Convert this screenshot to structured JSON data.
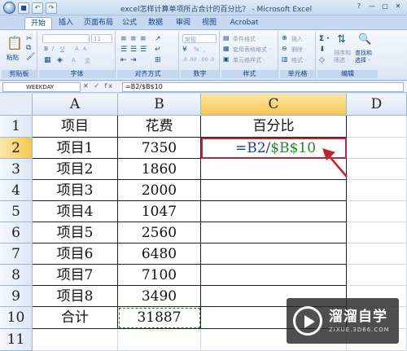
{
  "window": {
    "title": "excel怎样计算单项所占合计的百分比？ - Microsoft Excel",
    "controls": [
      "?",
      "—",
      "▢",
      "✕"
    ]
  },
  "qat": {
    "undo": "↶",
    "redo": "↷"
  },
  "tabs": [
    {
      "label": "开始",
      "active": true
    },
    {
      "label": "插入"
    },
    {
      "label": "页面布局"
    },
    {
      "label": "公式"
    },
    {
      "label": "数据"
    },
    {
      "label": "审阅"
    },
    {
      "label": "视图"
    },
    {
      "label": "Acrobat"
    }
  ],
  "ribbon": {
    "clipboard": {
      "label": "剪贴板",
      "paste": "粘贴"
    },
    "font": {
      "label": "字体",
      "size": "11",
      "bold": "B",
      "italic": "I",
      "underline": "U",
      "grow": "A",
      "shrink": "A",
      "color": "A",
      "wen": "文"
    },
    "alignment": {
      "label": "对齐方式"
    },
    "number": {
      "label": "数字",
      "format": "常规",
      "percent": "%",
      "comma": ",",
      "dec_inc": ".0 .00",
      "dec_dec": ".00 .0"
    },
    "styles": {
      "label": "样式",
      "cond": "条件格式 ·",
      "table": "套用表格格式 ·",
      "cell": "单元格样式 ·"
    },
    "cells": {
      "label": "单元格",
      "insert": "插入 ·",
      "delete": "删除 ·",
      "format": "格式 ·"
    },
    "editing": {
      "label": "编辑",
      "sigma": "Σ ·",
      "sort_label": "排序和\n筛选 ·",
      "find_label": "查找和\n选择 ·"
    }
  },
  "formulabar": {
    "namebox": "WEEKDAY",
    "buttons": "✕ ✓ fx",
    "content": "=B2/$B$10"
  },
  "sheet": {
    "columns": [
      "A",
      "B",
      "C",
      "D"
    ],
    "rows": [
      "1",
      "2",
      "3",
      "4",
      "5",
      "6",
      "7",
      "8",
      "9",
      "10",
      "11"
    ],
    "header": [
      "项目",
      "花费",
      "百分比"
    ],
    "data": [
      [
        "项目1",
        "7350"
      ],
      [
        "项目2",
        "1860"
      ],
      [
        "项目3",
        "2000"
      ],
      [
        "项目4",
        "1047"
      ],
      [
        "项目5",
        "2560"
      ],
      [
        "项目6",
        "6480"
      ],
      [
        "项目7",
        "7100"
      ],
      [
        "项目8",
        "3490"
      ]
    ],
    "total": [
      "合计",
      "31887"
    ],
    "formula": {
      "prefix": "=B2/",
      "ref": "$B$10"
    }
  },
  "annotation": {
    "color": "#c0262d"
  },
  "watermark": {
    "title": "溜溜自学",
    "url": "ZIXUE.3D66.COM"
  }
}
